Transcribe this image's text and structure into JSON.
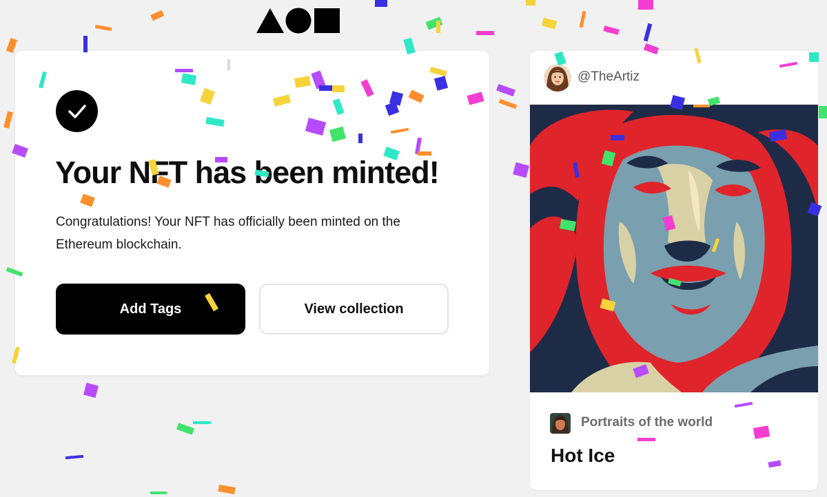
{
  "header": {
    "logo_icon": "triangle-circle-square-logo"
  },
  "success": {
    "icon": "checkmark-icon",
    "title": "Your NFT has been minted!",
    "message": "Congratulations! Your NFT has officially been minted on the Ethereum blockchain.",
    "primary_button": "Add Tags",
    "secondary_button": "View collection"
  },
  "nft": {
    "creator_handle": "@TheArtiz",
    "collection_name": "Portraits of the world",
    "title": "Hot Ice"
  },
  "colors": {
    "background": "#f1f1f1",
    "card": "#ffffff",
    "primary": "#000000",
    "art_red": "#e0242b",
    "art_navy": "#1e2b47",
    "art_blue": "#7a9fae",
    "art_cream": "#d9d1a6"
  }
}
